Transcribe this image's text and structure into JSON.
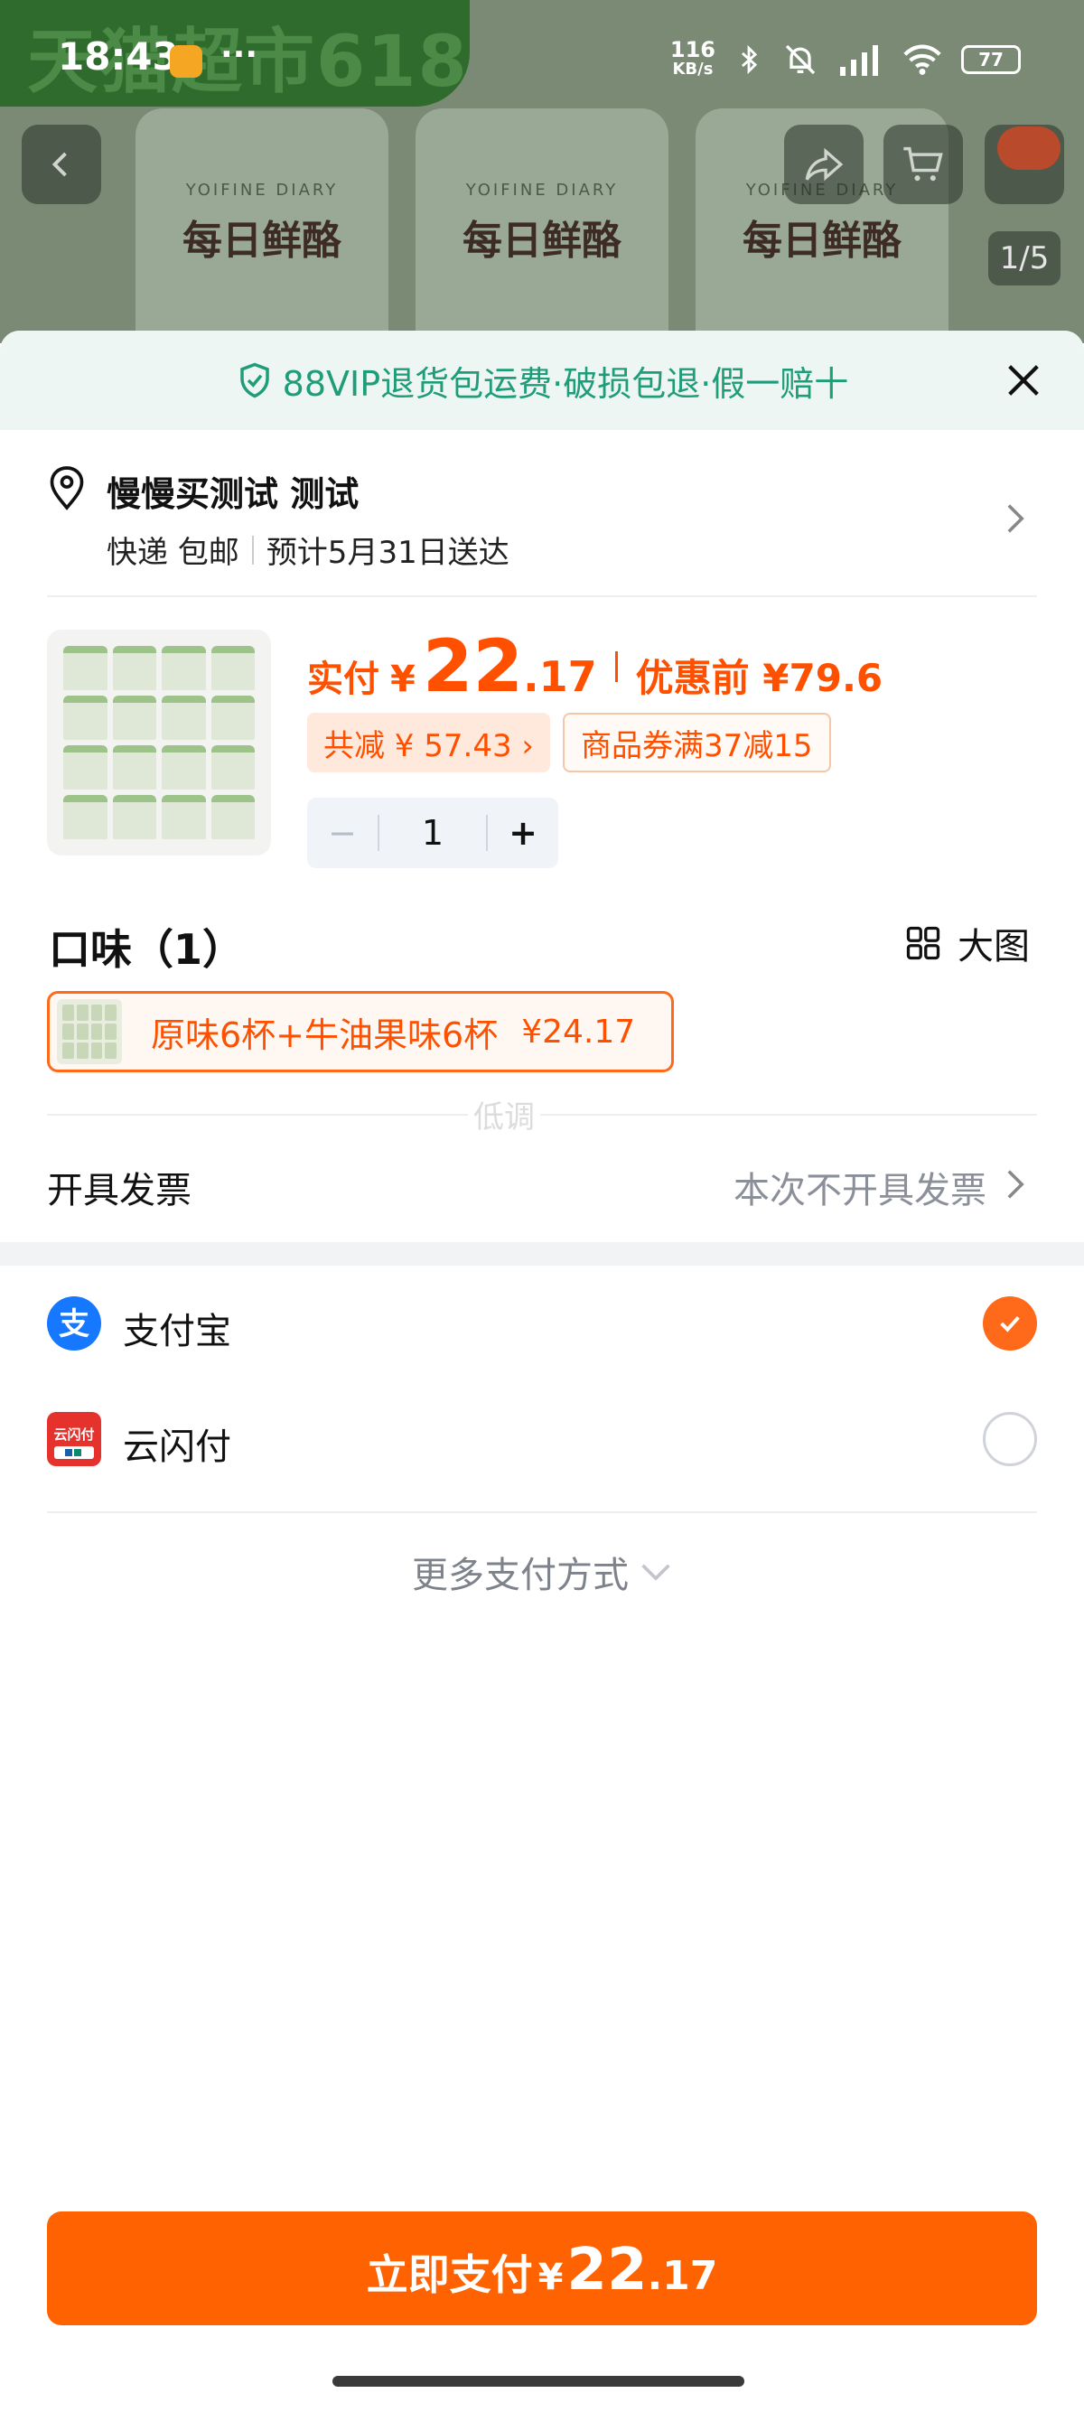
{
  "status_bar": {
    "time": "18:43",
    "net_speed_top": "116",
    "net_speed_unit": "KB/s",
    "battery": "77",
    "more": "···"
  },
  "background": {
    "banner": "天猫超市618",
    "brand_en": "YOIFINE DIARY",
    "brand_cn": "每日鲜酪",
    "image_counter": "1/5"
  },
  "sheet": {
    "vip_notice": "88VIP退货包运费·破损包退·假一赔十",
    "address": {
      "name": "慢慢买测试 测试",
      "delivery": "快递 包邮",
      "eta": "预计5月31日送达"
    },
    "price": {
      "label": "实付",
      "currency": "¥",
      "int": "22",
      "dec": ".17",
      "pre_label": "优惠前 ¥79.6",
      "discount": "共减 ¥ 57.43 ›",
      "coupon": "商品券满37减15"
    },
    "quantity": {
      "minus": "−",
      "value": "1",
      "plus": "+"
    },
    "flavor": {
      "title": "口味（1）",
      "view_label": "大图",
      "option_text": "原味6杯+牛油果味6杯",
      "option_price": "¥24.17"
    },
    "ghost_text": "低调",
    "invoice": {
      "label": "开具发票",
      "value": "本次不开具发票"
    },
    "payment": [
      {
        "name": "支付宝",
        "selected": true
      },
      {
        "name": "云闪付",
        "selected": false
      }
    ],
    "more_payment": "更多支付方式",
    "pay_button": {
      "label": "立即支付",
      "currency": "¥",
      "int": "22",
      "dec": ".17"
    }
  },
  "colors": {
    "accent": "#ff6200",
    "vip_green": "#1f9d79",
    "alipay_blue": "#1677ff",
    "unionpay_red": "#e5322d"
  }
}
